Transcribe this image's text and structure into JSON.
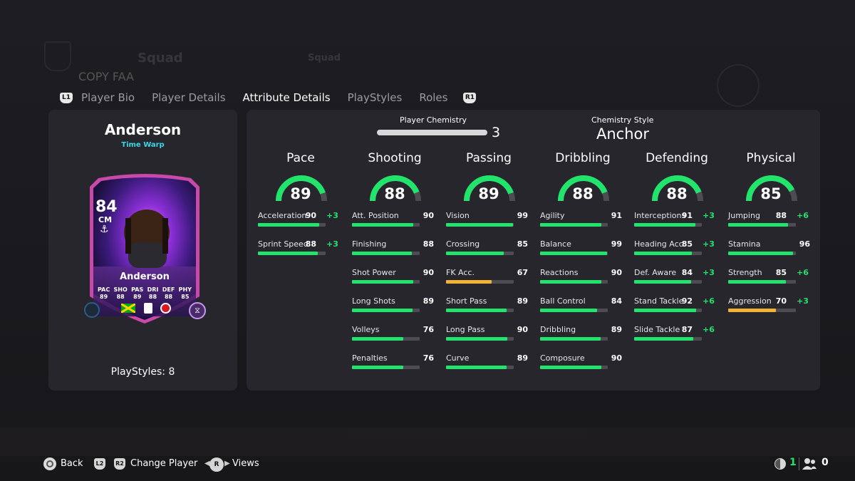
{
  "background": {
    "top_labels": [
      "Squad",
      "Squad"
    ],
    "behind_title": "COPY FAA"
  },
  "tabs": {
    "left_badge": "L1",
    "right_badge": "R1",
    "items": [
      {
        "label": "Player Bio",
        "active": false
      },
      {
        "label": "Player Details",
        "active": false
      },
      {
        "label": "Attribute Details",
        "active": true
      },
      {
        "label": "PlayStyles",
        "active": false
      },
      {
        "label": "Roles",
        "active": false
      }
    ]
  },
  "player": {
    "name": "Anderson",
    "card_type": "Time Warp",
    "playstyles_label": "PlayStyles: 8",
    "card": {
      "rating": "84",
      "position": "CM",
      "name": "Anderson",
      "stats": [
        {
          "label": "PAC",
          "value": "89"
        },
        {
          "label": "SHO",
          "value": "88"
        },
        {
          "label": "PAS",
          "value": "89"
        },
        {
          "label": "DRI",
          "value": "88"
        },
        {
          "label": "DEF",
          "value": "88"
        },
        {
          "label": "PHY",
          "value": "85"
        }
      ]
    }
  },
  "chemistry": {
    "player_chemistry_label": "Player Chemistry",
    "player_chemistry_value": "3",
    "style_label": "Chemistry Style",
    "style_value": "Anchor"
  },
  "colors": {
    "green": "#22e36c",
    "yellow": "#f2b233",
    "track": "#4c4c52",
    "accent_cyan": "#3ad6e6"
  },
  "categories": [
    {
      "title": "Pace",
      "value": "89",
      "attributes": [
        {
          "name": "Acceleration",
          "value": "90",
          "boost": "+3"
        },
        {
          "name": "Sprint Speed",
          "value": "88",
          "boost": "+3"
        }
      ]
    },
    {
      "title": "Shooting",
      "value": "88",
      "attributes": [
        {
          "name": "Att. Position",
          "value": "90",
          "boost": ""
        },
        {
          "name": "Finishing",
          "value": "88",
          "boost": ""
        },
        {
          "name": "Shot Power",
          "value": "90",
          "boost": ""
        },
        {
          "name": "Long Shots",
          "value": "89",
          "boost": ""
        },
        {
          "name": "Volleys",
          "value": "76",
          "boost": ""
        },
        {
          "name": "Penalties",
          "value": "76",
          "boost": ""
        }
      ]
    },
    {
      "title": "Passing",
      "value": "89",
      "attributes": [
        {
          "name": "Vision",
          "value": "99",
          "boost": ""
        },
        {
          "name": "Crossing",
          "value": "85",
          "boost": ""
        },
        {
          "name": "FK Acc.",
          "value": "67",
          "boost": ""
        },
        {
          "name": "Short Pass",
          "value": "89",
          "boost": ""
        },
        {
          "name": "Long Pass",
          "value": "90",
          "boost": ""
        },
        {
          "name": "Curve",
          "value": "89",
          "boost": ""
        }
      ]
    },
    {
      "title": "Dribbling",
      "value": "88",
      "attributes": [
        {
          "name": "Agility",
          "value": "91",
          "boost": ""
        },
        {
          "name": "Balance",
          "value": "99",
          "boost": ""
        },
        {
          "name": "Reactions",
          "value": "90",
          "boost": ""
        },
        {
          "name": "Ball Control",
          "value": "84",
          "boost": ""
        },
        {
          "name": "Dribbling",
          "value": "89",
          "boost": ""
        },
        {
          "name": "Composure",
          "value": "90",
          "boost": ""
        }
      ]
    },
    {
      "title": "Defending",
      "value": "88",
      "attributes": [
        {
          "name": "Interceptions",
          "value": "91",
          "boost": "+3"
        },
        {
          "name": "Heading Acc.",
          "value": "85",
          "boost": "+3"
        },
        {
          "name": "Def. Aware",
          "value": "84",
          "boost": "+3"
        },
        {
          "name": "Stand Tackle",
          "value": "92",
          "boost": "+6"
        },
        {
          "name": "Slide Tackle",
          "value": "87",
          "boost": "+6"
        }
      ]
    },
    {
      "title": "Physical",
      "value": "85",
      "attributes": [
        {
          "name": "Jumping",
          "value": "88",
          "boost": "+6"
        },
        {
          "name": "Stamina",
          "value": "96",
          "boost": ""
        },
        {
          "name": "Strength",
          "value": "85",
          "boost": "+6"
        },
        {
          "name": "Aggression",
          "value": "70",
          "boost": "+3"
        }
      ]
    }
  ],
  "footer": {
    "back_label": "Back",
    "l2": "L2",
    "r2": "R2",
    "change_player_label": "Change Player",
    "r_stick": "R",
    "views_label": "Views",
    "count_1": "1",
    "count_2": "0"
  }
}
